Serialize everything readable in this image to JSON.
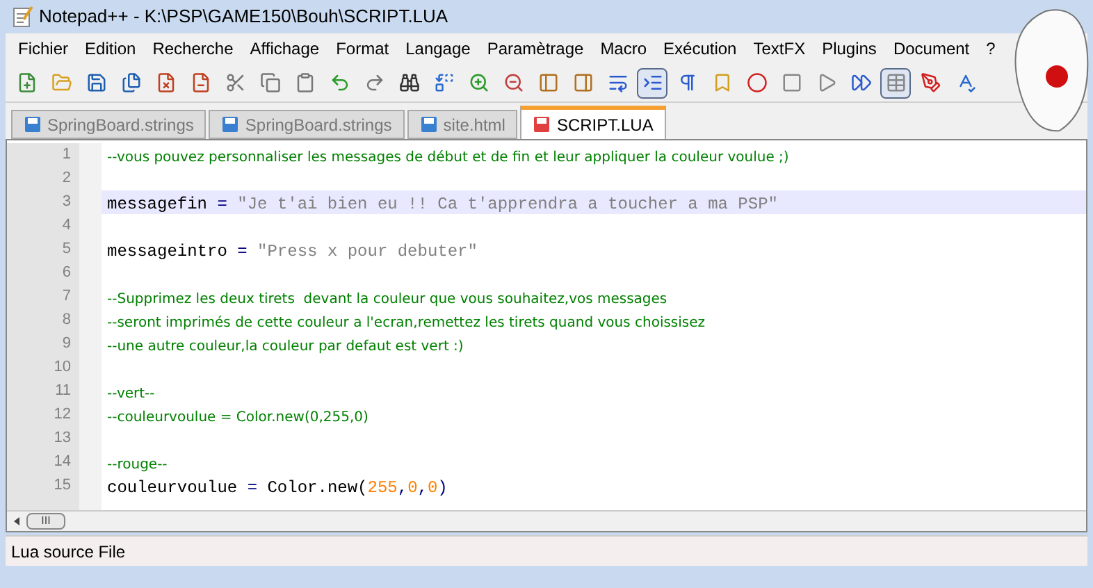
{
  "window": {
    "title": "Notepad++ - K:\\PSP\\GAME150\\Bouh\\SCRIPT.LUA"
  },
  "menu": [
    "Fichier",
    "Edition",
    "Recherche",
    "Affichage",
    "Format",
    "Langage",
    "Paramètrage",
    "Macro",
    "Exécution",
    "TextFX",
    "Plugins",
    "Document",
    "?"
  ],
  "toolbar": [
    {
      "pressed": false
    },
    {
      "pressed": false
    },
    {
      "pressed": false
    },
    {
      "pressed": false
    },
    {
      "pressed": false
    },
    {
      "pressed": false
    },
    {
      "pressed": false
    },
    {
      "pressed": false
    },
    {
      "pressed": false
    },
    {
      "pressed": false
    },
    {
      "pressed": false
    },
    {
      "pressed": false
    },
    {
      "pressed": false
    },
    {
      "pressed": false
    },
    {
      "pressed": false
    },
    {
      "pressed": false
    },
    {
      "pressed": false
    },
    {
      "pressed": false
    },
    {
      "pressed": true
    },
    {
      "pressed": false
    },
    {
      "pressed": false
    },
    {
      "pressed": false
    },
    {
      "pressed": false
    },
    {
      "pressed": false
    },
    {
      "pressed": false
    },
    {
      "pressed": true
    },
    {
      "pressed": false
    },
    {
      "pressed": false
    }
  ],
  "tabs": [
    {
      "label": "SpringBoard.strings",
      "selected": false
    },
    {
      "label": "SpringBoard.strings",
      "selected": false
    },
    {
      "label": "site.html",
      "selected": false
    },
    {
      "label": "SCRIPT.LUA",
      "selected": true
    }
  ],
  "editor": {
    "lines": [
      {
        "number": "1",
        "current": false,
        "segments": [
          {
            "kind": "comment",
            "text": "--vous pouvez personnaliser les messages de début et de fin et leur appliquer la couleur voulue ;)"
          }
        ]
      },
      {
        "number": "2",
        "current": false
      },
      {
        "number": "3",
        "current": true,
        "segments": [
          {
            "kind": "plain",
            "text": "messagefin "
          },
          {
            "kind": "op",
            "text": "="
          },
          {
            "kind": "string",
            "text": " \"Je t'ai bien eu !! Ca t'apprendra a toucher a ma PSP\""
          }
        ]
      },
      {
        "number": "4",
        "current": false
      },
      {
        "number": "5",
        "current": false,
        "segments": [
          {
            "kind": "plain",
            "text": "messageintro "
          },
          {
            "kind": "op",
            "text": "="
          },
          {
            "kind": "string",
            "text": " \"Press x pour debuter\""
          }
        ]
      },
      {
        "number": "6",
        "current": false
      },
      {
        "number": "7",
        "current": false,
        "segments": [
          {
            "kind": "comment",
            "text": "--Supprimez les deux tirets  devant la couleur que vous souhaitez,vos messages"
          }
        ]
      },
      {
        "number": "8",
        "current": false,
        "segments": [
          {
            "kind": "comment",
            "text": "--seront imprimés de cette couleur a l'ecran,remettez les tirets quand vous choissisez"
          }
        ]
      },
      {
        "number": "9",
        "current": false,
        "segments": [
          {
            "kind": "comment",
            "text": "--une autre couleur,la couleur par defaut est vert :)"
          }
        ]
      },
      {
        "number": "10",
        "current": false
      },
      {
        "number": "11",
        "current": false,
        "segments": [
          {
            "kind": "comment",
            "text": "--vert--"
          }
        ]
      },
      {
        "number": "12",
        "current": false,
        "segments": [
          {
            "kind": "comment",
            "text": "--couleurvoulue = Color.new(0,255,0)"
          }
        ]
      },
      {
        "number": "13",
        "current": false
      },
      {
        "number": "14",
        "current": false,
        "segments": [
          {
            "kind": "comment",
            "text": "--rouge--"
          }
        ]
      },
      {
        "number": "15",
        "current": false,
        "segments": [
          {
            "kind": "plain",
            "text": "couleurvoulue "
          },
          {
            "kind": "op",
            "text": "="
          },
          {
            "kind": "plain",
            "text": " Color.new("
          },
          {
            "kind": "number",
            "text": "255"
          },
          {
            "kind": "op",
            "text": ","
          },
          {
            "kind": "number",
            "text": "0"
          },
          {
            "kind": "op",
            "text": ","
          },
          {
            "kind": "number",
            "text": "0"
          },
          {
            "kind": "op",
            "text": ")"
          }
        ]
      }
    ]
  },
  "scrollbar": {
    "thumb": "III"
  },
  "status_bar": {
    "text": "Lua source File"
  }
}
